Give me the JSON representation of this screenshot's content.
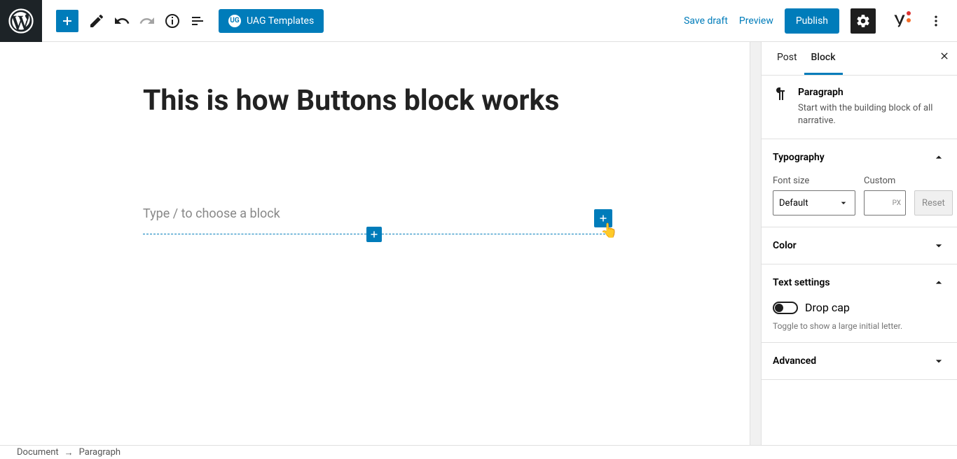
{
  "toolbar": {
    "uag_label": "UAG Templates",
    "uag_badge": "UG",
    "save_draft": "Save draft",
    "preview": "Preview",
    "publish": "Publish"
  },
  "editor": {
    "title": "This is how Buttons block works",
    "placeholder": "Type / to choose a block"
  },
  "sidebar": {
    "tabs": {
      "post": "Post",
      "block": "Block"
    },
    "block_name": "Paragraph",
    "block_desc": "Start with the building block of all narrative.",
    "typography": {
      "title": "Typography",
      "font_size_label": "Font size",
      "font_size_value": "Default",
      "custom_label": "Custom",
      "custom_unit": "PX",
      "reset": "Reset"
    },
    "color_title": "Color",
    "text_settings": {
      "title": "Text settings",
      "drop_cap": "Drop cap",
      "help": "Toggle to show a large initial letter."
    },
    "advanced_title": "Advanced"
  },
  "breadcrumb": {
    "document": "Document",
    "arrow": "→",
    "current": "Paragraph"
  }
}
